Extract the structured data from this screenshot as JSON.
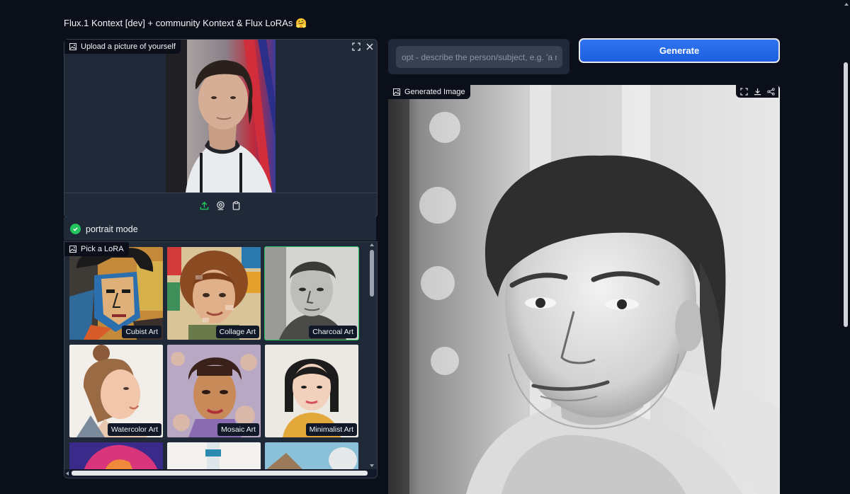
{
  "app": {
    "title": "Flux.1 Kontext [dev] + community Kontext & Flux LoRAs 🤗"
  },
  "upload": {
    "label": "Upload a picture of yourself",
    "toolbar_icons": [
      "upload-icon",
      "webcam-icon",
      "clipboard-icon"
    ],
    "header_icons": [
      "fullscreen-icon",
      "close-icon"
    ]
  },
  "portrait": {
    "label": "portrait mode",
    "checked": true
  },
  "lora": {
    "label": "Pick a LoRA",
    "items": [
      {
        "name": "Cubist Art"
      },
      {
        "name": "Collage Art"
      },
      {
        "name": "Charcoal Art"
      },
      {
        "name": "Watercolor Art"
      },
      {
        "name": "Mosaic Art"
      },
      {
        "name": "Minimalist Art"
      }
    ]
  },
  "prompt": {
    "value": "",
    "placeholder": "opt - describe the person/subject, e.g. 'a m"
  },
  "generate": {
    "label": "Generate"
  },
  "output": {
    "label": "Generated Image",
    "toolbar_icons": [
      "fullscreen-icon",
      "download-icon",
      "share-icon"
    ]
  },
  "colors": {
    "background": "#0b0f19",
    "panel": "#1f2937",
    "accent": "#2f74f0",
    "check": "#22c55e"
  }
}
